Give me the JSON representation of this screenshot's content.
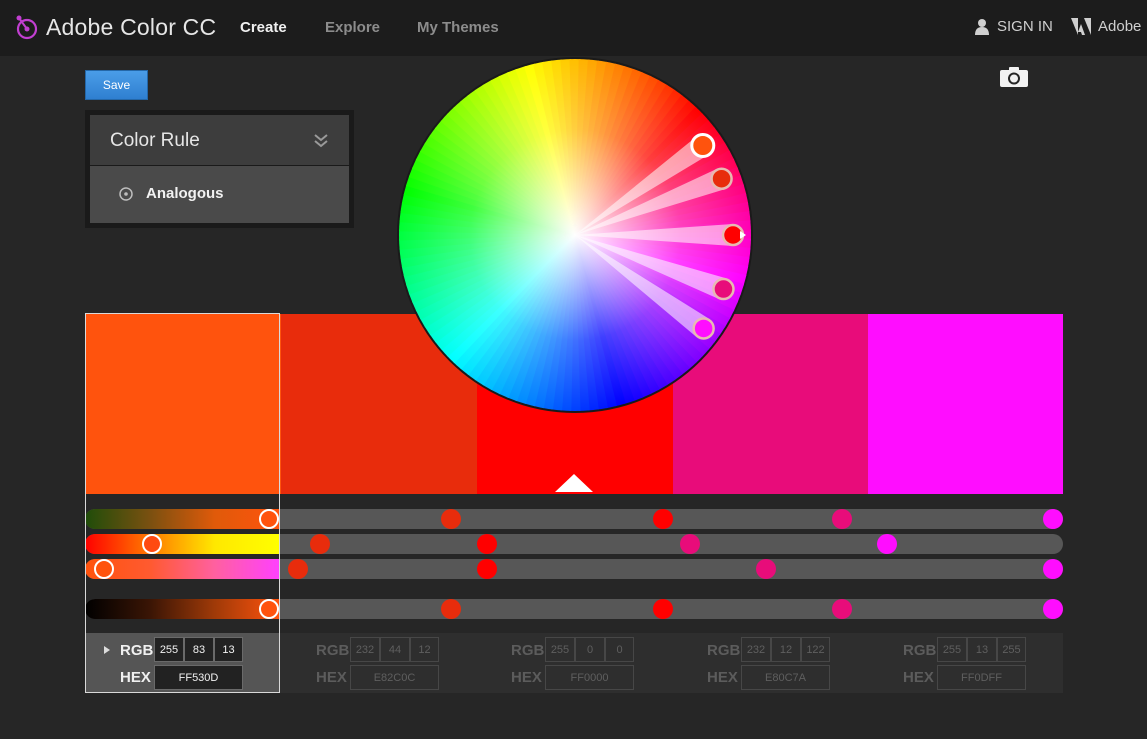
{
  "app": {
    "title": "Adobe Color CC"
  },
  "nav": {
    "create": "Create",
    "explore": "Explore",
    "my_themes": "My Themes"
  },
  "account": {
    "sign_in": "SIGN IN",
    "adobe": "Adobe"
  },
  "toolbar": {
    "save_label": "Save"
  },
  "color_rule": {
    "title": "Color Rule",
    "selected": "Analogous"
  },
  "labels": {
    "rgb": "RGB",
    "hex": "HEX"
  },
  "swatches": [
    {
      "hex": "FF530D",
      "r": "255",
      "g": "83",
      "b": "13",
      "color": "#FF530D",
      "selected": true
    },
    {
      "hex": "E82C0C",
      "r": "232",
      "g": "44",
      "b": "12",
      "color": "#E82C0C",
      "selected": false
    },
    {
      "hex": "FF0000",
      "r": "255",
      "g": "0",
      "b": "0",
      "color": "#FF0000",
      "selected": false
    },
    {
      "hex": "E80C7A",
      "r": "232",
      "g": "12",
      "b": "122",
      "color": "#E80C7A",
      "selected": false
    },
    {
      "hex": "FF0DFF",
      "r": "255",
      "g": "13",
      "b": "255",
      "color": "#FF0DFF",
      "selected": false
    }
  ],
  "colors": {
    "accent": "#2f86d6",
    "background": "#262626",
    "header": "#1c1c1c"
  }
}
